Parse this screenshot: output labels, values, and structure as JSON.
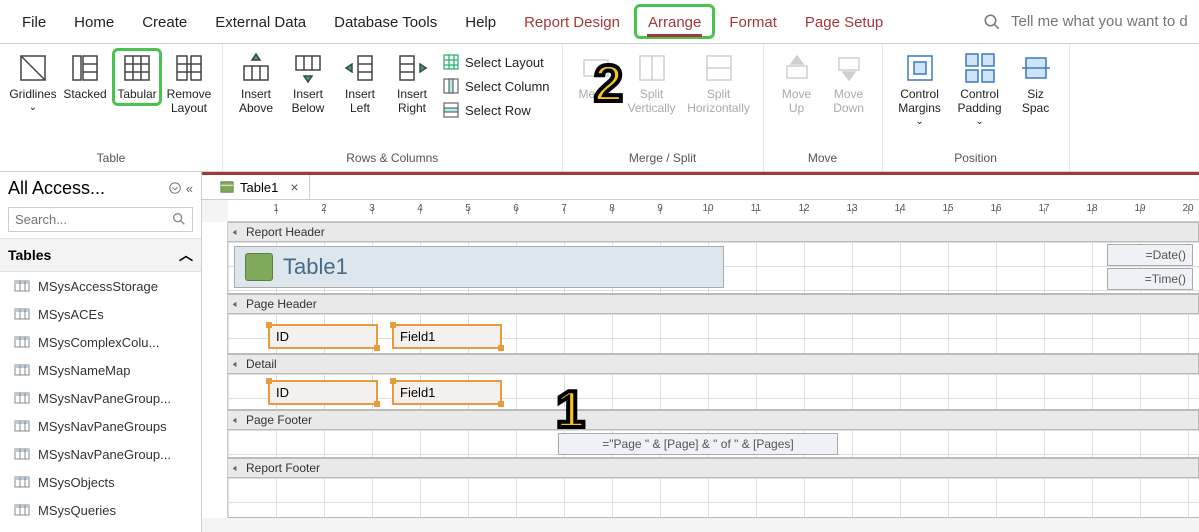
{
  "tabs": {
    "file": "File",
    "home": "Home",
    "create": "Create",
    "external": "External Data",
    "dbtools": "Database Tools",
    "help": "Help",
    "reportdesign": "Report Design",
    "arrange": "Arrange",
    "format": "Format",
    "pagesetup": "Page Setup"
  },
  "tellme_placeholder": "Tell me what you want to d",
  "ribbon": {
    "table": {
      "gridlines": "Gridlines",
      "stacked": "Stacked",
      "tabular": "Tabular",
      "remove": "Remove Layout",
      "group": "Table"
    },
    "rowscols": {
      "above": "Insert Above",
      "below": "Insert Below",
      "left": "Insert Left",
      "right": "Insert Right",
      "sel_layout": "Select Layout",
      "sel_col": "Select Column",
      "sel_row": "Select Row",
      "group": "Rows & Columns"
    },
    "merge": {
      "merge": "Merge",
      "splitv": "Split Vertically",
      "splith": "Split Horizontally",
      "group": "Merge / Split"
    },
    "move": {
      "up": "Move Up",
      "down": "Move Down",
      "group": "Move"
    },
    "position": {
      "margins": "Control Margins",
      "padding": "Control Padding",
      "size": "Siz Spac",
      "group": "Position"
    }
  },
  "nav": {
    "title": "All Access...",
    "search_placeholder": "Search...",
    "group": "Tables",
    "items": [
      "MSysAccessStorage",
      "MSysACEs",
      "MSysComplexColu...",
      "MSysNameMap",
      "MSysNavPaneGroup...",
      "MSysNavPaneGroups",
      "MSysNavPaneGroup...",
      "MSysObjects",
      "MSysQueries"
    ]
  },
  "doc": {
    "tab_label": "Table1",
    "sections": {
      "report_header": "Report Header",
      "page_header": "Page Header",
      "detail": "Detail",
      "page_footer": "Page Footer",
      "report_footer": "Report Footer"
    },
    "title": "Table1",
    "date_fn": "=Date()",
    "time_fn": "=Time()",
    "ph_id": "ID",
    "ph_field1": "Field1",
    "dt_id": "ID",
    "dt_field1": "Field1",
    "pagenum": "=\"Page \" & [Page] & \" of \" & [Pages]"
  },
  "markers": {
    "one": "1",
    "two": "2"
  }
}
